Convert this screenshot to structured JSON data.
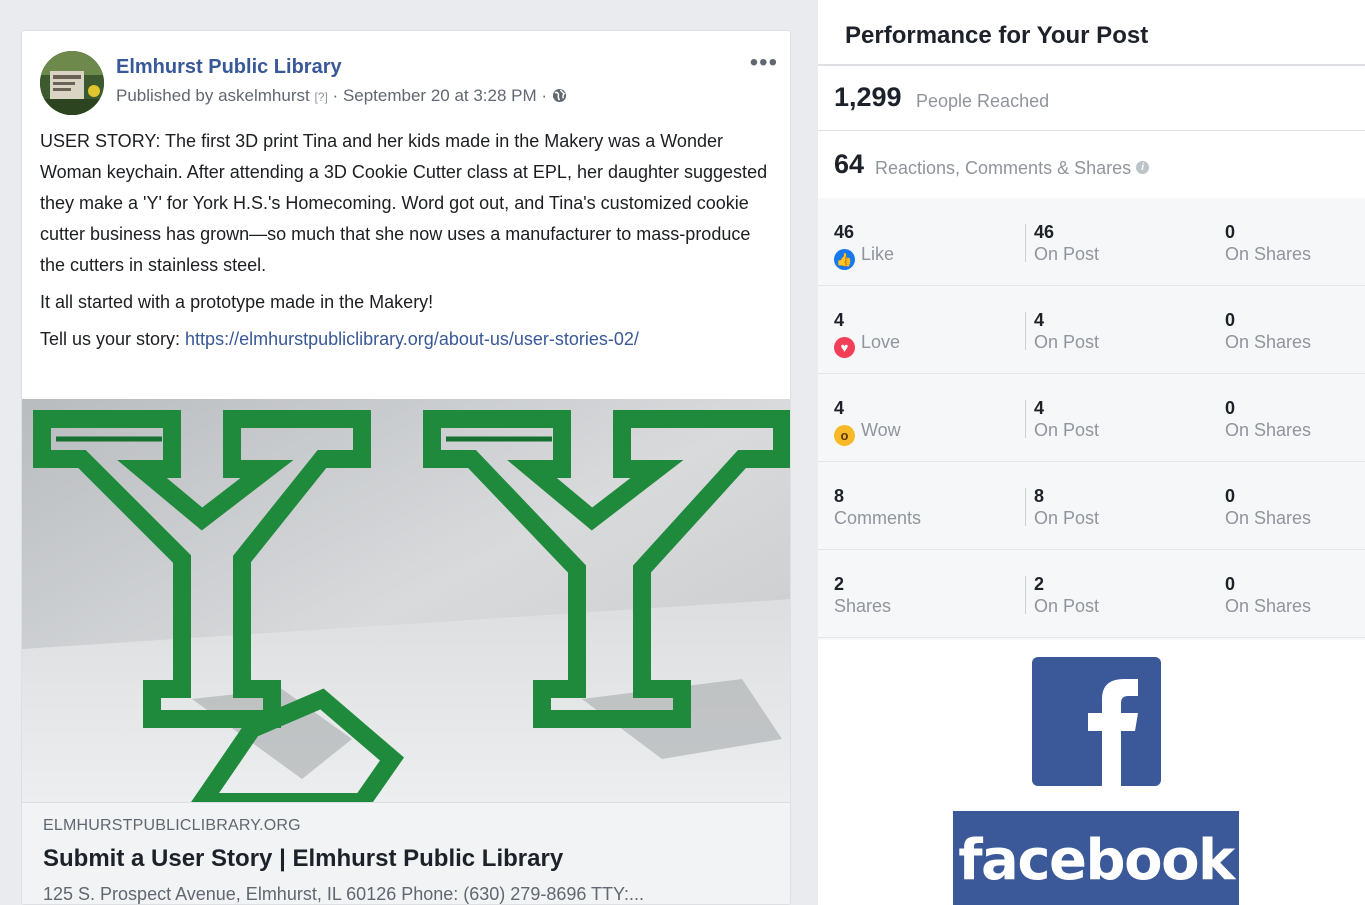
{
  "post": {
    "page_name": "Elmhurst Public Library",
    "published_by_prefix": "Published by",
    "author": "askelmhurst",
    "help_marker": "[?]",
    "separator": "·",
    "timestamp": "September 20 at 3:28 PM",
    "privacy_icon": "globe-icon",
    "more_label": "•••",
    "paragraphs": [
      "USER STORY: The first 3D print Tina and her kids made in the Makery was a Wonder Woman keychain. After attending a 3D Cookie Cutter class at EPL, her daughter suggested they make a 'Y' for York H.S.'s Homecoming. Word got out, and Tina's customized cookie cutter business has grown—so much that she now uses a manufacturer to mass-produce the cutters in stainless steel.",
      "It all started with a prototype made in the Makery!"
    ],
    "cta_prefix": "Tell us your story: ",
    "cta_link": "https://elmhurstpubliclibrary.org/about-us/user-stories-02/",
    "link_preview": {
      "domain": "ELMHURSTPUBLICLIBRARY.ORG",
      "title": "Submit a User Story | Elmhurst Public Library",
      "description": "125 S. Prospect Avenue, Elmhurst, IL 60126 Phone: (630) 279-8696 TTY:..."
    }
  },
  "performance": {
    "title": "Performance for Your Post",
    "reach": {
      "value": "1,299",
      "label": "People Reached"
    },
    "engagement": {
      "value": "64",
      "label": "Reactions, Comments & Shares"
    },
    "rows": [
      {
        "total": "46",
        "name": "Like",
        "icon": "like-icon",
        "on_post": "46",
        "on_post_label": "On Post",
        "on_shares": "0",
        "on_shares_label": "On Shares"
      },
      {
        "total": "4",
        "name": "Love",
        "icon": "love-icon",
        "on_post": "4",
        "on_post_label": "On Post",
        "on_shares": "0",
        "on_shares_label": "On Shares"
      },
      {
        "total": "4",
        "name": "Wow",
        "icon": "wow-icon",
        "on_post": "4",
        "on_post_label": "On Post",
        "on_shares": "0",
        "on_shares_label": "On Shares"
      },
      {
        "total": "8",
        "name": "Comments",
        "icon": "",
        "on_post": "8",
        "on_post_label": "On Post",
        "on_shares": "0",
        "on_shares_label": "On Shares"
      },
      {
        "total": "2",
        "name": "Shares",
        "icon": "",
        "on_post": "2",
        "on_post_label": "On Post",
        "on_shares": "0",
        "on_shares_label": "On Shares"
      }
    ]
  },
  "branding": {
    "logo_letter": "f",
    "wordmark": "facebook",
    "brand_color": "#3b5998"
  },
  "colors": {
    "link": "#385898",
    "muted": "#90949c",
    "page_bg": "#e9ebee",
    "cutter_green": "#1f8a3c"
  }
}
